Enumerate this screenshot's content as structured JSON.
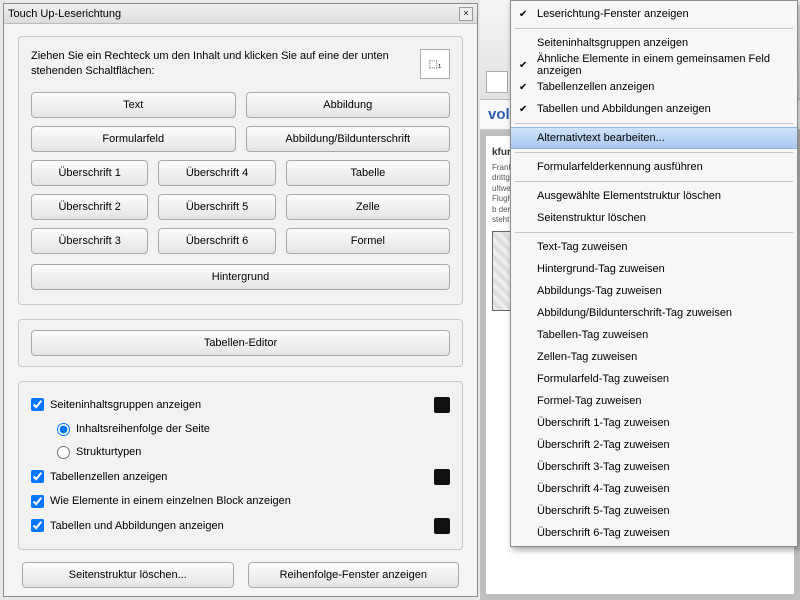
{
  "dialog": {
    "title": "Touch Up-Leserichtung",
    "instruction": "Ziehen Sie ein Rechteck um den Inhalt und klicken Sie auf eine der unten stehenden Schaltflächen:",
    "buttons": {
      "text": "Text",
      "image": "Abbildung",
      "form": "Formularfeld",
      "imgcap": "Abbildung/Bildunterschrift",
      "h1": "Überschrift 1",
      "h2": "Überschrift 2",
      "h3": "Überschrift 3",
      "h4": "Überschrift 4",
      "h5": "Überschrift 5",
      "h6": "Überschrift 6",
      "table": "Tabelle",
      "cell": "Zelle",
      "formula": "Formel",
      "background": "Hintergrund"
    },
    "table_editor": "Tabellen-Editor",
    "options": {
      "show_groups": "Seiteninhaltsgruppen anzeigen",
      "order": "Inhaltsreihenfolge der Seite",
      "struct_types": "Strukturtypen",
      "show_cells": "Tabellenzellen anzeigen",
      "show_block": "Wie Elemente in einem einzelnen Block anzeigen",
      "show_tb": "Tabellen und Abbildungen anzeigen"
    },
    "footer": {
      "clear": "Seitenstruktur löschen...",
      "order_panel": "Reihenfolge-Fenster anzeigen"
    }
  },
  "app": {
    "heading": "voll",
    "doc_title": "kfurter Air"
  },
  "menu": {
    "items": [
      {
        "label": "Leserichtung-Fenster anzeigen",
        "checked": true
      },
      {
        "label": "Seiteninhaltsgruppen anzeigen",
        "checked": false
      },
      {
        "label": "Ähnliche Elemente in einem gemeinsamen Feld anzeigen",
        "checked": true
      },
      {
        "label": "Tabellenzellen anzeigen",
        "checked": true
      },
      {
        "label": "Tabellen und Abbildungen anzeigen",
        "checked": true
      }
    ],
    "alt_text": "Alternativtext bearbeiten...",
    "group2": [
      "Formularfelderkennung ausführen",
      "Ausgewählte Elementstruktur löschen",
      "Seitenstruktur löschen"
    ],
    "tags": [
      "Text-Tag zuweisen",
      "Hintergrund-Tag zuweisen",
      "Abbildungs-Tag zuweisen",
      "Abbildung/Bildunterschrift-Tag zuweisen",
      "Tabellen-Tag zuweisen",
      "Zellen-Tag zuweisen",
      "Formularfeld-Tag zuweisen",
      "Formel-Tag zuweisen",
      "Überschrift 1-Tag zuweisen",
      "Überschrift 2-Tag zuweisen",
      "Überschrift 3-Tag zuweisen",
      "Überschrift 4-Tag zuweisen",
      "Überschrift 5-Tag zuweisen",
      "Überschrift 6-Tag zuweisen"
    ]
  }
}
